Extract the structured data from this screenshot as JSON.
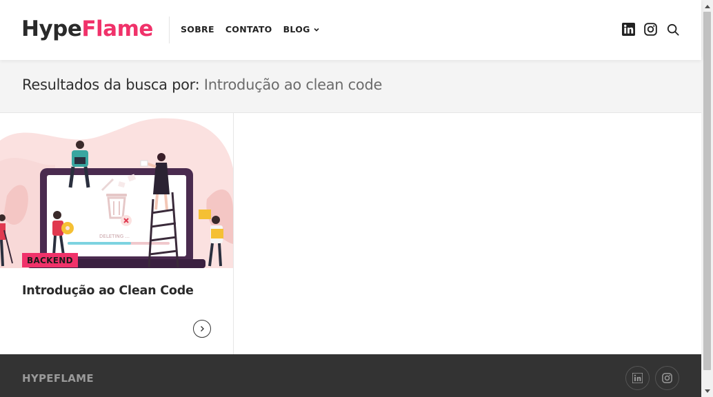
{
  "header": {
    "logo_part1": "Hype",
    "logo_part2": "Flame",
    "nav": [
      {
        "label": "SOBRE"
      },
      {
        "label": "CONTATO"
      },
      {
        "label": "BLOG"
      }
    ],
    "icons": [
      "linkedin-icon",
      "instagram-icon",
      "search-icon"
    ]
  },
  "search": {
    "prefix": "Resultados da busca por: ",
    "term": "Introdução ao clean code"
  },
  "results": [
    {
      "category": "BACKEND",
      "title": "Introdução ao Clean Code",
      "illustration_text": "DELETING ..."
    }
  ],
  "footer": {
    "brand": "HYPEFLAME",
    "icons": [
      "linkedin-icon",
      "instagram-icon"
    ]
  },
  "colors": {
    "accent": "#f0326a",
    "footer_bg": "#333333",
    "band_bg": "#f4f4f4"
  }
}
